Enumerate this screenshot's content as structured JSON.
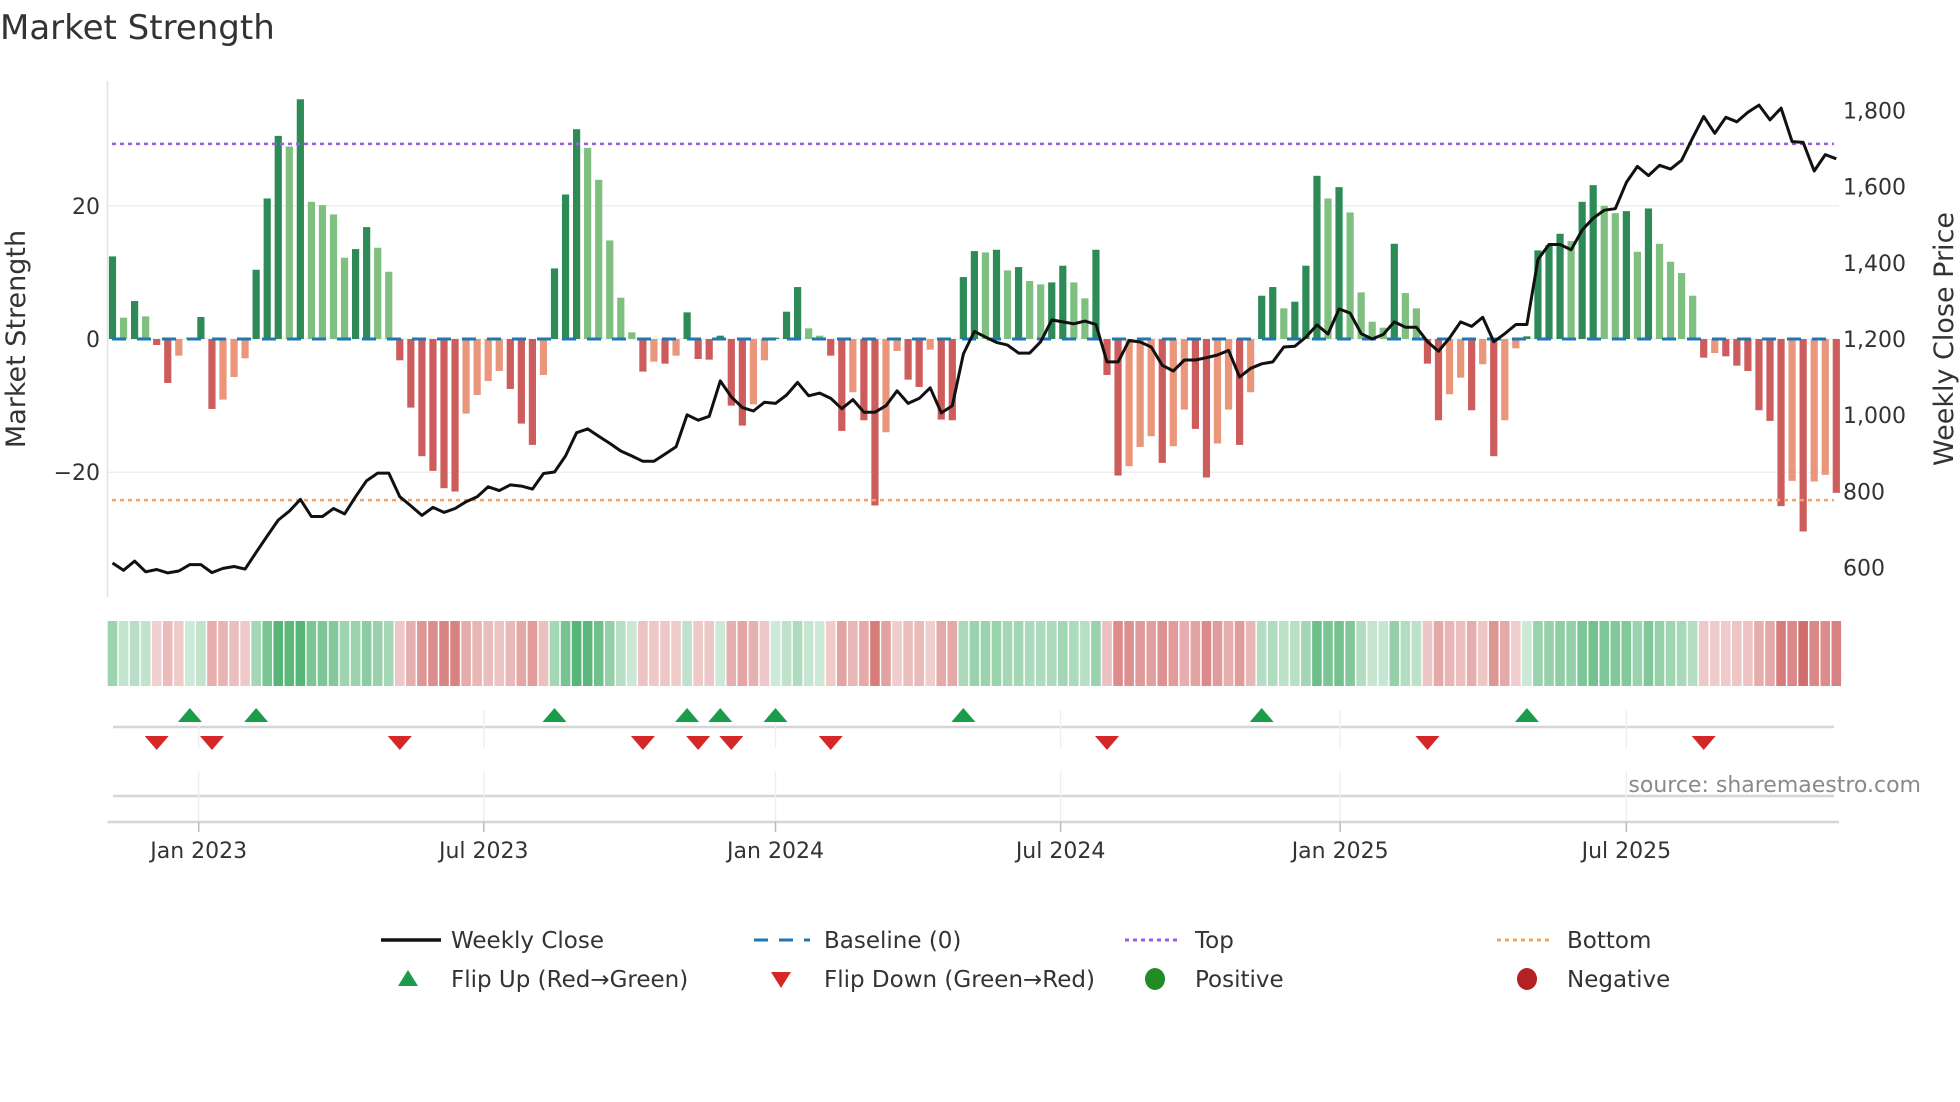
{
  "title": "Market Strength",
  "source": "source: sharemaestro.com",
  "colors": {
    "pos_strong": "#2e8b57",
    "pos_weak": "#7fbf7f",
    "neg_strong": "#cd5c5c",
    "neg_weak": "#e9967a",
    "price": "#111111",
    "baseline": "#1f77b4",
    "top": "#9b5de5",
    "bottom": "#f4a460",
    "flip_up": "#1a9c4a",
    "flip_down": "#d62728",
    "positive": "#228b22",
    "negative": "#b22222"
  },
  "chart_data": {
    "type": "bar",
    "title": "Market Strength",
    "ylabel": "Market Strength",
    "y2label": "Weekly Close Price",
    "ylim": [
      -39,
      39
    ],
    "y2lim": [
      550,
      1830
    ],
    "yticks": [
      {
        "v": 20,
        "label": "20"
      },
      {
        "v": 0,
        "label": "0"
      },
      {
        "v": -20,
        "label": "−20"
      }
    ],
    "y2ticks": [
      {
        "v": 1800,
        "label": "1,800"
      },
      {
        "v": 1600,
        "label": "1,600"
      },
      {
        "v": 1400,
        "label": "1,400"
      },
      {
        "v": 1200,
        "label": "1,200"
      },
      {
        "v": 1000,
        "label": "1,000"
      },
      {
        "v": 800,
        "label": "800"
      },
      {
        "v": 600,
        "label": "600"
      }
    ],
    "xticks": [
      {
        "week": 8.8,
        "label": "Jan 2023"
      },
      {
        "week": 34.6,
        "label": "Jul 2023"
      },
      {
        "week": 61.0,
        "label": "Jan 2024"
      },
      {
        "week": 86.8,
        "label": "Jul 2024"
      },
      {
        "week": 112.1,
        "label": "Jan 2025"
      },
      {
        "week": 138.0,
        "label": "Jul 2025"
      }
    ],
    "top_level": 29.3,
    "bottom_level": -24.2,
    "baseline": 0,
    "strength": [
      12.4,
      3.2,
      5.7,
      3.4,
      -0.9,
      -6.6,
      -2.5,
      0.2,
      3.3,
      -10.5,
      -9.1,
      -5.7,
      -2.9,
      10.4,
      21.1,
      30.5,
      28.9,
      36.0,
      20.6,
      20.1,
      18.7,
      12.2,
      13.5,
      16.8,
      13.7,
      10.1,
      -3.2,
      -10.3,
      -17.6,
      -19.8,
      -22.4,
      -22.9,
      -11.2,
      -8.4,
      -6.3,
      -4.8,
      -7.5,
      -12.7,
      -15.9,
      -5.4,
      10.6,
      21.7,
      31.5,
      28.7,
      23.9,
      14.8,
      6.2,
      1.0,
      -4.9,
      -3.4,
      -3.7,
      -2.5,
      4.0,
      -3.0,
      -3.1,
      0.5,
      -10.0,
      -13.0,
      -9.8,
      -3.2,
      0.2,
      4.1,
      7.8,
      1.6,
      0.5,
      -2.5,
      -13.8,
      -8.0,
      -12.2,
      -25.0,
      -14.0,
      -1.8,
      -6.1,
      -7.2,
      -1.6,
      -12.1,
      -12.2,
      9.3,
      13.2,
      13.0,
      13.4,
      10.3,
      10.8,
      8.7,
      8.2,
      8.5,
      11.0,
      8.5,
      6.1,
      13.4,
      -5.4,
      -20.5,
      -19.1,
      -16.2,
      -14.6,
      -18.6,
      -16.1,
      -10.6,
      -13.5,
      -20.8,
      -15.7,
      -10.6,
      -15.9,
      -8.0,
      6.5,
      7.8,
      4.6,
      5.6,
      11.0,
      24.5,
      21.1,
      22.8,
      19.0,
      7.0,
      2.6,
      1.7,
      14.3,
      6.9,
      4.6,
      -3.7,
      -12.2,
      -8.3,
      -5.8,
      -10.7,
      -3.8,
      -17.6,
      -12.2,
      -1.4,
      0.4,
      13.3,
      14.1,
      15.8,
      14.7,
      20.6,
      23.1,
      20.0,
      18.9,
      19.2,
      13.1,
      19.6,
      14.3,
      11.6,
      9.9,
      6.5,
      -2.8,
      -2.1,
      -2.6,
      -4.0,
      -4.8,
      -10.7,
      -12.3,
      -25.1,
      -21.3,
      -28.9,
      -21.4,
      -20.4,
      -23.1
    ],
    "weekly_close": [
      612,
      593,
      617,
      589,
      595,
      586,
      591,
      608,
      608,
      587,
      598,
      603,
      596,
      640,
      683,
      725,
      748,
      779,
      734,
      734,
      755,
      741,
      786,
      828,
      848,
      848,
      786,
      762,
      737,
      758,
      745,
      755,
      773,
      786,
      812,
      802,
      817,
      814,
      806,
      847,
      851,
      893,
      954,
      964,
      945,
      926,
      906,
      893,
      879,
      879,
      898,
      917,
      1001,
      987,
      997,
      1090,
      1048,
      1020,
      1011,
      1034,
      1031,
      1053,
      1086,
      1051,
      1058,
      1044,
      1017,
      1041,
      1008,
      1008,
      1025,
      1064,
      1031,
      1044,
      1072,
      1006,
      1025,
      1161,
      1220,
      1205,
      1191,
      1184,
      1163,
      1163,
      1193,
      1250,
      1245,
      1240,
      1247,
      1238,
      1140,
      1140,
      1196,
      1192,
      1179,
      1131,
      1116,
      1145,
      1145,
      1151,
      1158,
      1170,
      1100,
      1123,
      1135,
      1140,
      1179,
      1181,
      1205,
      1237,
      1213,
      1279,
      1268,
      1214,
      1200,
      1212,
      1245,
      1231,
      1231,
      1193,
      1168,
      1203,
      1245,
      1233,
      1257,
      1193,
      1214,
      1238,
      1238,
      1409,
      1448,
      1448,
      1434,
      1486,
      1517,
      1538,
      1542,
      1611,
      1653,
      1629,
      1656,
      1646,
      1669,
      1728,
      1784,
      1740,
      1782,
      1770,
      1795,
      1814,
      1775,
      1806,
      1718,
      1716,
      1641,
      1684,
      1673
    ],
    "flip_up_weeks": [
      8,
      14,
      41,
      53,
      56,
      61,
      78,
      105,
      129
    ],
    "flip_down_weeks": [
      5,
      10,
      27,
      49,
      54,
      57,
      66,
      91,
      120,
      145
    ],
    "legend": [
      {
        "key": "weekly_close",
        "label": "Weekly Close"
      },
      {
        "key": "baseline",
        "label": "Baseline (0)"
      },
      {
        "key": "top",
        "label": "Top"
      },
      {
        "key": "bottom",
        "label": "Bottom"
      },
      {
        "key": "flip_up",
        "label": "Flip Up (Red→Green)"
      },
      {
        "key": "flip_down",
        "label": "Flip Down (Green→Red)"
      },
      {
        "key": "positive",
        "label": "Positive"
      },
      {
        "key": "negative",
        "label": "Negative"
      }
    ],
    "legend_position": "bottom"
  }
}
